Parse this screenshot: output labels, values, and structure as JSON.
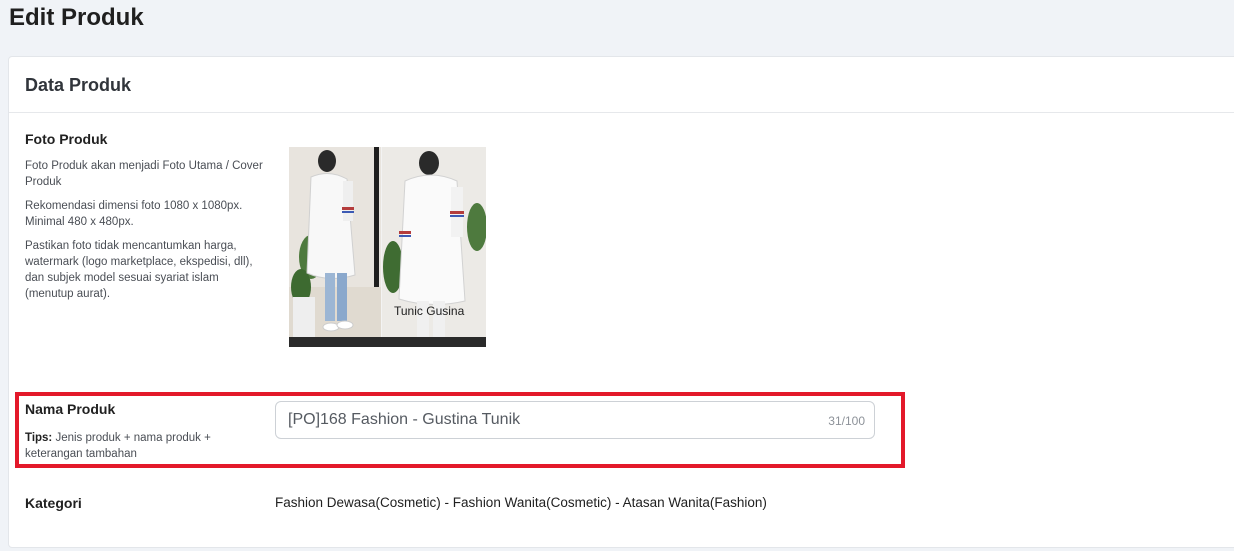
{
  "page": {
    "title": "Edit Produk"
  },
  "card": {
    "title": "Data Produk"
  },
  "photo_section": {
    "label": "Foto Produk",
    "desc1": "Foto Produk akan menjadi Foto Utama / Cover Produk",
    "desc2": "Rekomendasi dimensi foto 1080 x 1080px. Minimal 480 x 480px.",
    "desc3": "Pastikan foto tidak mencantumkan harga, watermark (logo marketplace, ekspedisi, dll), dan subjek model sesuai syariat islam (menutup aurat).",
    "image_caption": "Tunic Gusina"
  },
  "name_section": {
    "label": "Nama Produk",
    "tips_label": "Tips:",
    "tips_text": " Jenis produk + nama produk + keterangan tambahan",
    "value": "[PO]168 Fashion - Gustina Tunik",
    "counter": "31/100"
  },
  "category_section": {
    "label": "Kategori",
    "value": "Fashion Dewasa(Cosmetic) - Fashion Wanita(Cosmetic) - Atasan Wanita(Fashion)"
  },
  "colors": {
    "highlight": "#e3192a",
    "background": "#f0f3f7"
  }
}
